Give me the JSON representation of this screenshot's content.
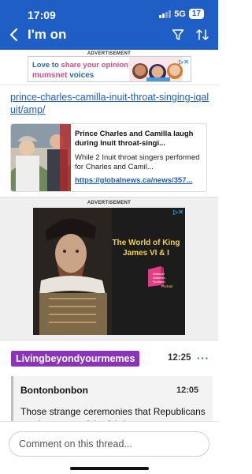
{
  "status_bar": {
    "time": "17:09",
    "network": "5G",
    "battery": "17"
  },
  "nav": {
    "title": "I'm on"
  },
  "ad_top": {
    "label": "ADVERTISEMENT",
    "line1_a": "Love to ",
    "line1_b": "share your opinion?",
    "line2_a": "mumsnet",
    "line2_b": " voices"
  },
  "post": {
    "link_text": "prince-charles-camilla-inuit-throat-singing-iqaluit/amp/",
    "card": {
      "title": "Prince Charles and Camilla laugh during Inuit throat-singi...",
      "description": "While 2 Inuit throat singers performed for Charles and Camil...",
      "url": "https://globalnews.ca/news/357..."
    }
  },
  "ad_mid": {
    "label": "ADVERTISEMENT",
    "title": "The World of King James VI & I",
    "logo_text": "National Galleries Scotland",
    "logo_sub": "Portrait"
  },
  "comment": {
    "username": "Livingbeyondyourmemes",
    "time": "12:25",
    "more": "···",
    "quote": {
      "username": "Bontonbonbon",
      "time": "12:05",
      "text": "Those strange ceremonies that Republicans mock are part of the fabric"
    }
  },
  "footer": {
    "placeholder": "Comment on this thread..."
  },
  "colors": {
    "brand_blue": "#1f5ec5",
    "username_purple": "#8a34b9",
    "ad_title_yellow": "#f2d04a"
  }
}
